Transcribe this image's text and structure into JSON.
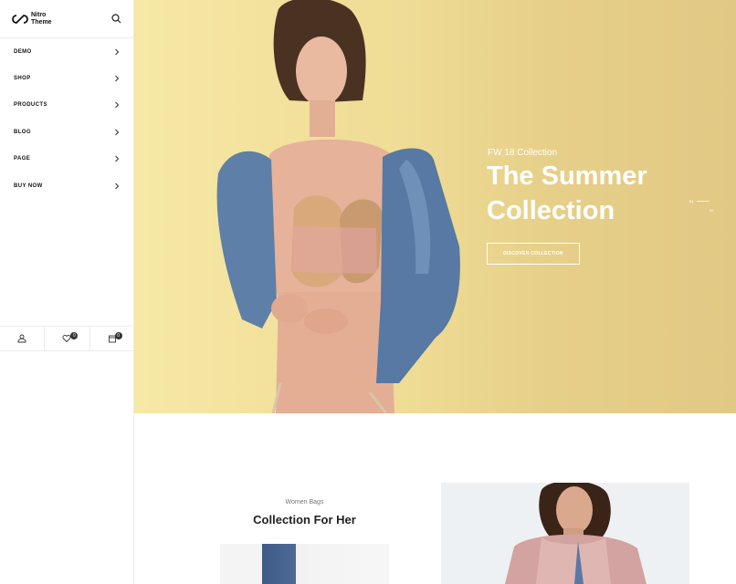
{
  "brand": {
    "name_line1": "Nitro",
    "name_line2": "Theme"
  },
  "menu": [
    {
      "label": "DEMO"
    },
    {
      "label": "SHOP"
    },
    {
      "label": "PRODUCTS"
    },
    {
      "label": "BLOG"
    },
    {
      "label": "PAGE"
    },
    {
      "label": "BUY NOW"
    }
  ],
  "footer": {
    "wishlist_count": "0",
    "cart_count": "0"
  },
  "hero": {
    "subtitle": "FW 18 Collection",
    "title": "The Summer Collection",
    "button_label": "DISCOVER COLLECTION",
    "slide_current": "01",
    "slide_total": "02"
  },
  "section": {
    "label": "Women Bags",
    "title": "Collection For Her"
  },
  "colors": {
    "hero_bg": "#efdc95",
    "accent_text": "#ffffff",
    "text_dark": "#222222"
  }
}
